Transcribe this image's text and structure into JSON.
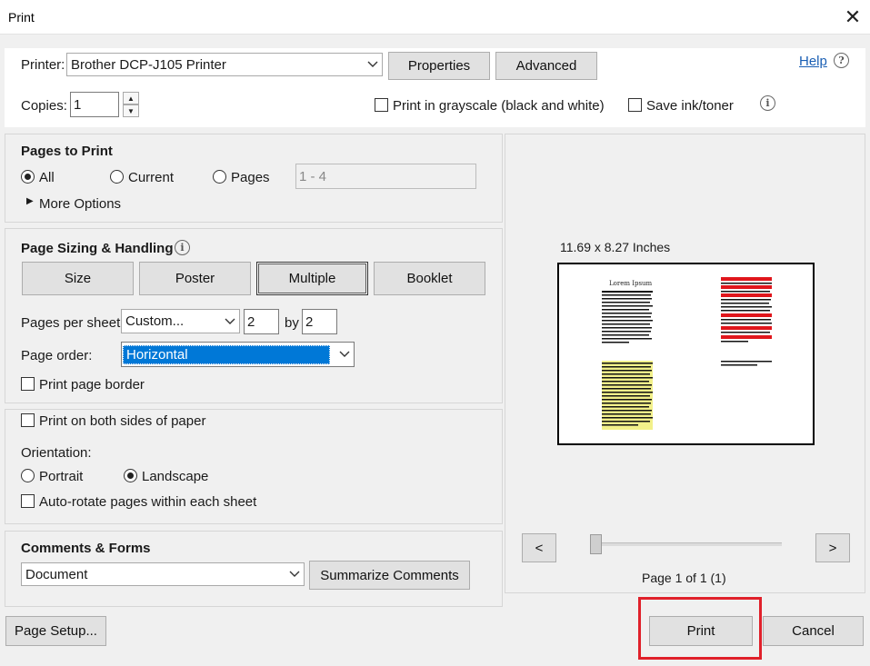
{
  "window": {
    "title": "Print",
    "close_glyph": "✕"
  },
  "printer": {
    "label": "Printer:",
    "value": "Brother DCP-J105 Printer",
    "properties_label": "Properties",
    "advanced_label": "Advanced",
    "help_label": "Help"
  },
  "copies": {
    "label": "Copies:",
    "value": "1"
  },
  "options": {
    "grayscale_label": "Print in grayscale (black and white)",
    "save_ink_label": "Save ink/toner"
  },
  "pages_to_print": {
    "title": "Pages to Print",
    "all_label": "All",
    "current_label": "Current",
    "pages_label": "Pages",
    "pages_placeholder": "1 - 4",
    "more_options_label": "More Options",
    "selected": "All"
  },
  "sizing": {
    "title": "Page Sizing & Handling",
    "size_label": "Size",
    "poster_label": "Poster",
    "multiple_label": "Multiple",
    "booklet_label": "Booklet",
    "selected": "Multiple",
    "pages_per_sheet_label": "Pages per sheet:",
    "pages_per_sheet_value": "Custom...",
    "cols_value": "2",
    "by_label": "by",
    "rows_value": "2",
    "page_order_label": "Page order:",
    "page_order_value": "Horizontal",
    "border_label": "Print page border"
  },
  "duplex": {
    "both_sides_label": "Print on both sides of paper",
    "orientation_label": "Orientation:",
    "portrait_label": "Portrait",
    "landscape_label": "Landscape",
    "selected": "Landscape",
    "auto_rotate_label": "Auto-rotate pages within each sheet"
  },
  "comments": {
    "title": "Comments & Forms",
    "value": "Document",
    "summarize_label": "Summarize Comments"
  },
  "preview": {
    "size_text": "11.69 x 8.27 Inches",
    "page_counter": "Page 1 of 1 (1)",
    "thumb_title": "Lorem Ipsum",
    "prev_label": "<",
    "next_label": ">"
  },
  "footer": {
    "page_setup_label": "Page Setup...",
    "print_label": "Print",
    "cancel_label": "Cancel"
  },
  "colors": {
    "highlight_blue": "#0078d7",
    "print_box_red": "#e0202a",
    "link_blue": "#1a5fb4"
  }
}
